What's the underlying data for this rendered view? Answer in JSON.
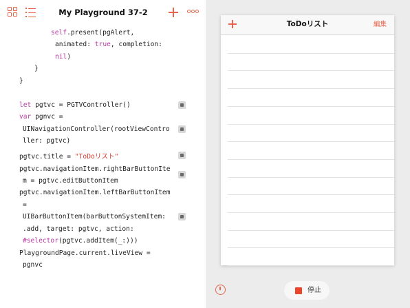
{
  "header": {
    "title": "My Playground 37-2",
    "icons": [
      "grid-icon",
      "list-icon",
      "add-icon",
      "more-icon"
    ]
  },
  "code": {
    "lines": [
      [
        {
          "t": "self",
          "c": "kw"
        },
        {
          "t": ".present(pgAlert,"
        }
      ],
      [
        {
          "t": "animated: "
        },
        {
          "t": "true",
          "c": "kw"
        },
        {
          "t": ", completion:"
        }
      ],
      [
        {
          "t": "nil",
          "c": "kw"
        },
        {
          "t": ")"
        }
      ],
      [
        {
          "t": "}"
        }
      ],
      [
        {
          "t": "}"
        }
      ],
      [
        {
          "t": "let",
          "c": "kw"
        },
        {
          "t": " pgtvc = PGTVController()"
        }
      ],
      [
        {
          "t": "var",
          "c": "kw"
        },
        {
          "t": " pgnvc ="
        }
      ],
      [
        {
          "t": "UINavigationController(rootViewContro"
        }
      ],
      [
        {
          "t": "ller: pgtvc)"
        }
      ],
      [
        {
          "t": "pgtvc.title = "
        },
        {
          "t": "\"ToDoリスト\"",
          "c": "str"
        }
      ],
      [
        {
          "t": "pgtvc.navigationItem.rightBarButtonIte"
        }
      ],
      [
        {
          "t": "m = pgtvc.editButtonItem"
        }
      ],
      [
        {
          "t": "pgtvc.navigationItem.leftBarButtonItem"
        }
      ],
      [
        {
          "t": "="
        }
      ],
      [
        {
          "t": "UIBarButtonItem(barButtonSystemItem:"
        }
      ],
      [
        {
          "t": ".add, target: pgtvc, action:"
        }
      ],
      [
        {
          "t": "#selector",
          "c": "kw"
        },
        {
          "t": "(pgtvc.addItem(_:)))"
        }
      ],
      [
        {
          "t": "PlaygroundPage.current.liveView ="
        }
      ],
      [
        {
          "t": "pgnvc"
        }
      ]
    ]
  },
  "liveview": {
    "nav_title": "ToDoリスト",
    "edit_label": "編集",
    "row_count": 13
  },
  "controls": {
    "stop_label": "停止"
  },
  "colors": {
    "accent": "#e8644a",
    "keyword": "#b83aa0",
    "string": "#d23b2b",
    "stop": "#e8452b",
    "liveview_bg": "#ececec"
  }
}
